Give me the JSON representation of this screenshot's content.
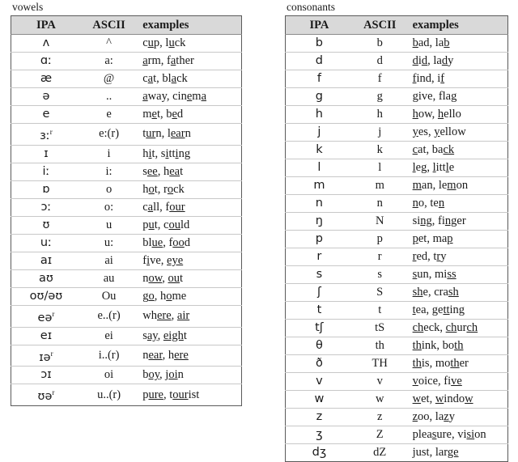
{
  "sections": [
    {
      "id": "vowels",
      "label": "vowels",
      "columns": [
        "IPA",
        "ASCII",
        "examples"
      ],
      "rows": [
        {
          "ipa": "ʌ",
          "sup": "",
          "ascii": "^",
          "examples": [
            [
              "c",
              "u",
              "p"
            ],
            [
              "l",
              "u",
              "ck"
            ]
          ]
        },
        {
          "ipa": "ɑː",
          "sup": "",
          "ascii": "a:",
          "examples": [
            [
              "",
              "a",
              "rm"
            ],
            [
              "f",
              "a",
              "ther"
            ]
          ]
        },
        {
          "ipa": "æ",
          "sup": "",
          "ascii": "@",
          "examples": [
            [
              "c",
              "a",
              "t"
            ],
            [
              "bl",
              "a",
              "ck"
            ]
          ]
        },
        {
          "ipa": "ə",
          "sup": "",
          "ascii": "..",
          "examples": [
            [
              "",
              "a",
              "way"
            ],
            [
              "cin",
              "e",
              "m",
              "a"
            ]
          ]
        },
        {
          "ipa": "e",
          "sup": "",
          "ascii": "e",
          "examples": [
            [
              "m",
              "e",
              "t"
            ],
            [
              "b",
              "e",
              "d"
            ]
          ]
        },
        {
          "ipa": "ɜː",
          "sup": "r",
          "ascii": "e:(r)",
          "examples": [
            [
              "t",
              "ur",
              "n"
            ],
            [
              "l",
              "ear",
              "n"
            ]
          ]
        },
        {
          "ipa": "ɪ",
          "sup": "",
          "ascii": "i",
          "examples": [
            [
              "h",
              "i",
              "t"
            ],
            [
              "s",
              "i",
              "tt",
              "i",
              "ng"
            ]
          ]
        },
        {
          "ipa": "iː",
          "sup": "",
          "ascii": "i:",
          "examples": [
            [
              "s",
              "ee",
              ""
            ],
            [
              "h",
              "ea",
              "t"
            ]
          ]
        },
        {
          "ipa": "ɒ",
          "sup": "",
          "ascii": "o",
          "examples": [
            [
              "h",
              "o",
              "t"
            ],
            [
              "r",
              "o",
              "ck"
            ]
          ]
        },
        {
          "ipa": "ɔː",
          "sup": "",
          "ascii": "o:",
          "examples": [
            [
              "c",
              "a",
              "ll"
            ],
            [
              "f",
              "our",
              ""
            ]
          ]
        },
        {
          "ipa": "ʊ",
          "sup": "",
          "ascii": "u",
          "examples": [
            [
              "p",
              "u",
              "t"
            ],
            [
              "c",
              "ou",
              "ld"
            ]
          ]
        },
        {
          "ipa": "uː",
          "sup": "",
          "ascii": "u:",
          "examples": [
            [
              "bl",
              "ue",
              ""
            ],
            [
              "f",
              "oo",
              "d"
            ]
          ]
        },
        {
          "ipa": "aɪ",
          "sup": "",
          "ascii": "ai",
          "examples": [
            [
              "f",
              "i",
              "ve"
            ],
            [
              "",
              "eye",
              ""
            ]
          ]
        },
        {
          "ipa": "aʊ",
          "sup": "",
          "ascii": "au",
          "examples": [
            [
              "n",
              "ow",
              ""
            ],
            [
              "",
              "ou",
              "t"
            ]
          ]
        },
        {
          "ipa": "oʊ/əʊ",
          "sup": "",
          "ascii": "Ou",
          "examples": [
            [
              "g",
              "o",
              ""
            ],
            [
              "h",
              "o",
              "me"
            ]
          ]
        },
        {
          "ipa": "eə",
          "sup": "r",
          "ascii": "e..(r)",
          "examples": [
            [
              "wh",
              "ere",
              ""
            ],
            [
              "",
              "air",
              ""
            ]
          ]
        },
        {
          "ipa": "eɪ",
          "sup": "",
          "ascii": "ei",
          "examples": [
            [
              "s",
              "ay",
              ""
            ],
            [
              "",
              "eigh",
              "t"
            ]
          ]
        },
        {
          "ipa": "ɪə",
          "sup": "r",
          "ascii": "i..(r)",
          "examples": [
            [
              "n",
              "ear",
              ""
            ],
            [
              "h",
              "ere",
              ""
            ]
          ]
        },
        {
          "ipa": "ɔɪ",
          "sup": "",
          "ascii": "oi",
          "examples": [
            [
              "b",
              "oy",
              ""
            ],
            [
              "j",
              "oi",
              "n"
            ]
          ]
        },
        {
          "ipa": "ʊə",
          "sup": "r",
          "ascii": "u..(r)",
          "examples": [
            [
              "p",
              "ure",
              ""
            ],
            [
              "t",
              "our",
              "ist"
            ]
          ]
        }
      ]
    },
    {
      "id": "consonants",
      "label": "consonants",
      "columns": [
        "IPA",
        "ASCII",
        "examples"
      ],
      "rows": [
        {
          "ipa": "b",
          "sup": "",
          "ascii": "b",
          "examples": [
            [
              "",
              "b",
              "ad"
            ],
            [
              "la",
              "b",
              ""
            ]
          ]
        },
        {
          "ipa": "d",
          "sup": "",
          "ascii": "d",
          "examples": [
            [
              "",
              "d",
              "i",
              "d"
            ],
            [
              "la",
              "d",
              "y"
            ]
          ]
        },
        {
          "ipa": "f",
          "sup": "",
          "ascii": "f",
          "examples": [
            [
              "",
              "f",
              "ind"
            ],
            [
              "i",
              "f",
              ""
            ]
          ]
        },
        {
          "ipa": "g",
          "sup": "",
          "ascii": "g",
          "examples": [
            [
              "",
              "g",
              "ive"
            ],
            [
              "fla",
              "g",
              ""
            ]
          ]
        },
        {
          "ipa": "h",
          "sup": "",
          "ascii": "h",
          "examples": [
            [
              "",
              "h",
              "ow"
            ],
            [
              "",
              "h",
              "ello"
            ]
          ]
        },
        {
          "ipa": "j",
          "sup": "",
          "ascii": "j",
          "examples": [
            [
              "",
              "y",
              "es"
            ],
            [
              "",
              "y",
              "ellow"
            ]
          ]
        },
        {
          "ipa": "k",
          "sup": "",
          "ascii": "k",
          "examples": [
            [
              "",
              "c",
              "at"
            ],
            [
              "ba",
              "ck",
              ""
            ]
          ]
        },
        {
          "ipa": "l",
          "sup": "",
          "ascii": "l",
          "examples": [
            [
              "",
              "l",
              "eg"
            ],
            [
              "",
              "l",
              "itt",
              "l",
              "e"
            ]
          ]
        },
        {
          "ipa": "m",
          "sup": "",
          "ascii": "m",
          "examples": [
            [
              "",
              "m",
              "an"
            ],
            [
              "le",
              "m",
              "on"
            ]
          ]
        },
        {
          "ipa": "n",
          "sup": "",
          "ascii": "n",
          "examples": [
            [
              "",
              "n",
              "o"
            ],
            [
              "te",
              "n",
              ""
            ]
          ]
        },
        {
          "ipa": "ŋ",
          "sup": "",
          "ascii": "N",
          "examples": [
            [
              "si",
              "ng",
              ""
            ],
            [
              "fi",
              "ng",
              "er"
            ]
          ]
        },
        {
          "ipa": "p",
          "sup": "",
          "ascii": "p",
          "examples": [
            [
              "",
              "p",
              "et"
            ],
            [
              "ma",
              "p",
              ""
            ]
          ]
        },
        {
          "ipa": "r",
          "sup": "",
          "ascii": "r",
          "examples": [
            [
              "",
              "r",
              "ed"
            ],
            [
              "t",
              "r",
              "y"
            ]
          ]
        },
        {
          "ipa": "s",
          "sup": "",
          "ascii": "s",
          "examples": [
            [
              "",
              "s",
              "un"
            ],
            [
              "mi",
              "ss",
              ""
            ]
          ]
        },
        {
          "ipa": "ʃ",
          "sup": "",
          "ascii": "S",
          "examples": [
            [
              "",
              "sh",
              "e"
            ],
            [
              "cra",
              "sh",
              ""
            ]
          ]
        },
        {
          "ipa": "t",
          "sup": "",
          "ascii": "t",
          "examples": [
            [
              "",
              "t",
              "ea"
            ],
            [
              "ge",
              "tt",
              "ing"
            ]
          ]
        },
        {
          "ipa": "tʃ",
          "sup": "",
          "ascii": "tS",
          "examples": [
            [
              "",
              "ch",
              "eck"
            ],
            [
              "",
              "ch",
              "ur",
              "ch"
            ]
          ]
        },
        {
          "ipa": "θ",
          "sup": "",
          "ascii": "th",
          "examples": [
            [
              "",
              "th",
              "ink"
            ],
            [
              "bo",
              "th",
              ""
            ]
          ]
        },
        {
          "ipa": "ð",
          "sup": "",
          "ascii": "TH",
          "examples": [
            [
              "",
              "th",
              "is"
            ],
            [
              "mo",
              "th",
              "er"
            ]
          ]
        },
        {
          "ipa": "v",
          "sup": "",
          "ascii": "v",
          "examples": [
            [
              "",
              "v",
              "oice"
            ],
            [
              "fi",
              "ve",
              ""
            ]
          ]
        },
        {
          "ipa": "w",
          "sup": "",
          "ascii": "w",
          "examples": [
            [
              "",
              "w",
              "et"
            ],
            [
              "",
              "w",
              "indo",
              "w",
              ""
            ]
          ]
        },
        {
          "ipa": "z",
          "sup": "",
          "ascii": "z",
          "examples": [
            [
              "",
              "z",
              "oo"
            ],
            [
              "la",
              "z",
              "y"
            ]
          ]
        },
        {
          "ipa": "ʒ",
          "sup": "",
          "ascii": "Z",
          "examples": [
            [
              "plea",
              "s",
              "ure"
            ],
            [
              "vi",
              "si",
              "on"
            ]
          ]
        },
        {
          "ipa": "dʒ",
          "sup": "",
          "ascii": "dZ",
          "examples": [
            [
              "",
              "j",
              "ust"
            ],
            [
              "lar",
              "ge",
              ""
            ]
          ]
        }
      ]
    }
  ],
  "colors": {
    "header_background": "#d9d9d9",
    "table_border": "#5a5a5a",
    "row_line": "#c8c8c8",
    "text": "#1a1a1a",
    "page_background": "#ffffff"
  }
}
